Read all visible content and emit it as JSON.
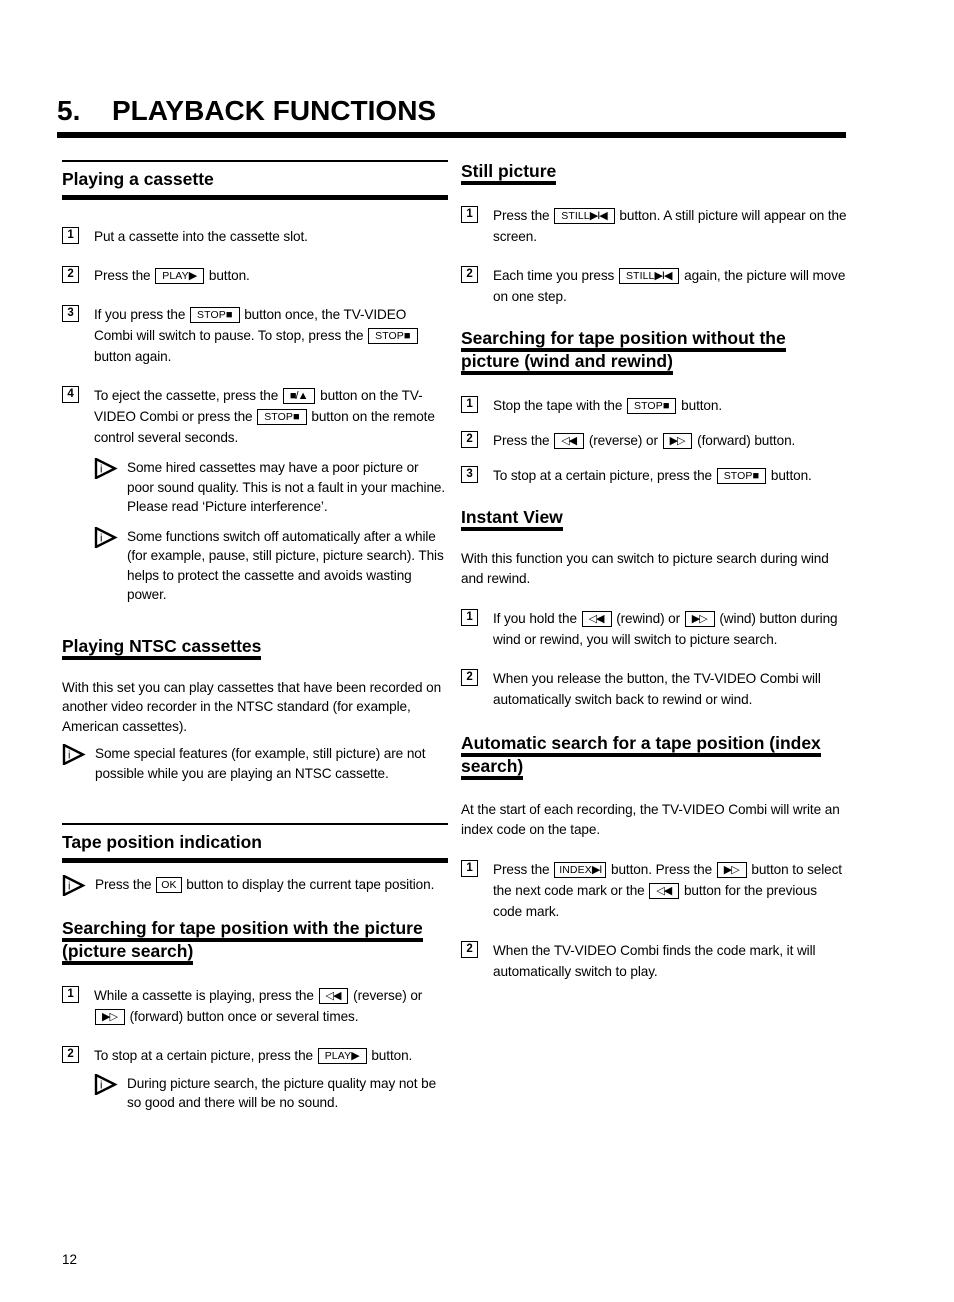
{
  "chapter": {
    "number": "5.",
    "title": "PLAYBACK FUNCTIONS"
  },
  "page_number": "12",
  "keys": {
    "play": "PLAY",
    "play_glyph": "▶",
    "stop": "STOP",
    "stop_glyph": "■",
    "eject_glyph": "■/▲",
    "still": "STILL",
    "still_glyph": "▶I◀",
    "index": "INDEX",
    "index_glyph": "▶I",
    "reverse_glyph": "◁◀",
    "forward_glyph": "▶▷",
    "ok": "OK"
  },
  "left_column": {
    "playing_cassette": {
      "heading": "Playing a cassette",
      "step1": {
        "num": "1",
        "text": "Put a cassette into the cassette slot."
      },
      "step2": {
        "num": "2",
        "text_before": "Press the",
        "text_after": "button."
      },
      "step3": {
        "num": "3",
        "text_a": "If you press the",
        "text_b": "button once, the TV-VIDEO Combi will switch to pause. To stop, press the",
        "text_c": "button again."
      },
      "step4": {
        "num": "4",
        "text_a": "To eject the cassette, press the",
        "text_b": "button on the TV-VIDEO Combi or press the",
        "text_c": "button on the remote control several seconds."
      },
      "note1": "Some hired cassettes may have a poor picture or poor sound quality. This is not a fault in your machine. Please read ‘Picture interference’.",
      "note2": "Some functions switch off automatically after a while (for example, pause, still picture, picture search). This helps to protect the cassette and avoids wasting power."
    },
    "playing_ntsc": {
      "heading": "Playing NTSC cassettes",
      "body": "With this set you can play cassettes that have been recorded on another video recorder in the NTSC standard (for example, American cassettes).",
      "note": "Some special features (for example, still picture) are not possible while you are playing an NTSC cassette."
    },
    "tape_position": {
      "heading": "Tape position indication",
      "note_before": "Press the",
      "note_after": "button to display the current tape position."
    },
    "picture_search": {
      "heading_line1": "Searching for tape position with the picture",
      "heading_line2": "(picture search)",
      "step1": {
        "num": "1",
        "text_a": "While a cassette is playing, press the",
        "text_b": "(reverse) or",
        "text_c": "(forward) button once or several times."
      },
      "step2": {
        "num": "2",
        "text_a": "To stop at a certain picture, press the",
        "text_b": "button."
      },
      "note": "During picture search, the picture quality may not be so good and there will be no sound."
    }
  },
  "right_column": {
    "still_picture": {
      "heading": "Still picture",
      "step1": {
        "num": "1",
        "text_a": "Press the",
        "text_b": "button. A still picture will appear on the screen."
      },
      "step2": {
        "num": "2",
        "text_a": "Each time you press",
        "text_b": "again, the picture will move on one step."
      }
    },
    "wind_rewind": {
      "heading_line1": "Searching for tape position without the",
      "heading_line2": "picture (wind and rewind)",
      "step1": {
        "num": "1",
        "text_a": "Stop the tape with the",
        "text_b": "button."
      },
      "step2": {
        "num": "2",
        "text_a": "Press the",
        "text_b": "(reverse) or",
        "text_c": "(forward) button."
      },
      "step3": {
        "num": "3",
        "text_a": "To stop at a certain picture, press the",
        "text_b": "button."
      }
    },
    "instant_view": {
      "heading": "Instant View",
      "body": "With this function you can switch to picture search during wind and rewind.",
      "step1": {
        "num": "1",
        "text_a": "If you hold the",
        "text_b": "(rewind) or",
        "text_c": "(wind) button during wind or rewind, you will switch to picture search."
      },
      "step2": {
        "num": "2",
        "text": "When you release the button, the TV-VIDEO Combi will automatically switch back to rewind or wind."
      }
    },
    "index_search": {
      "heading_line1": "Automatic search for a tape position (index",
      "heading_line2": "search)",
      "body": "At the start of each recording, the TV-VIDEO Combi will write an index code on the tape.",
      "step1": {
        "num": "1",
        "text_a": "Press the",
        "text_b": "button. Press the",
        "text_c": "button to select the next code mark or the",
        "text_d": "button for the previous code mark."
      },
      "step2": {
        "num": "2",
        "text": "When the TV-VIDEO Combi finds the code mark, it will automatically switch to play."
      }
    }
  }
}
